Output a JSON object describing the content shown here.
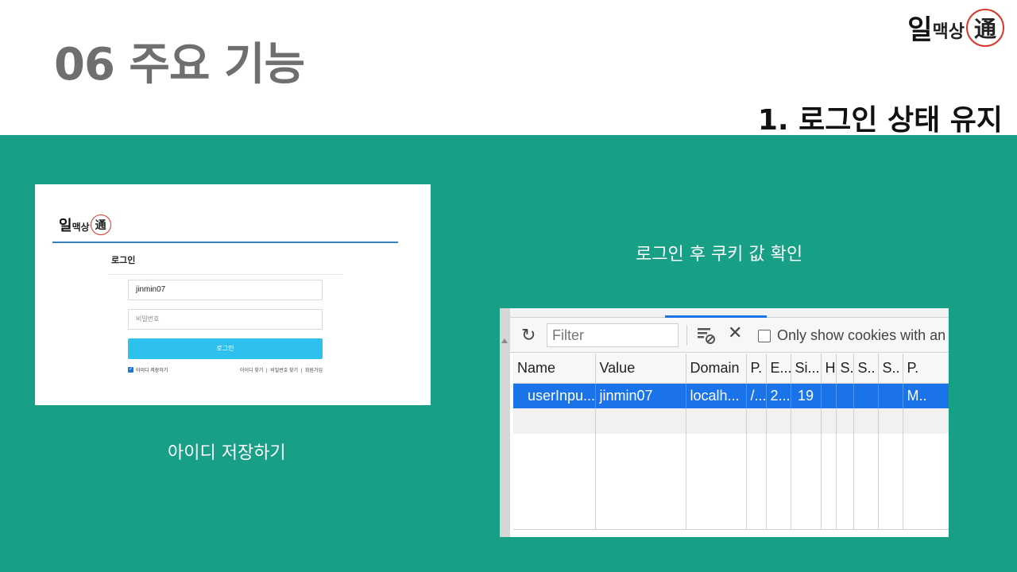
{
  "slide": {
    "title": "06 주요 기능",
    "section": "1. 로그인 상태 유지",
    "brand": {
      "part1": "일",
      "part2": "맥상",
      "seal": "通"
    }
  },
  "login_screenshot": {
    "heading": "로그인",
    "id_value": "jinmin07",
    "password_placeholder": "비밀번호",
    "login_button": "로그인",
    "remember_label": "아이디 저장하기",
    "links": [
      "아이디 찾기",
      "비밀번호 찾기",
      "회원가입"
    ],
    "separator": "|"
  },
  "captions": {
    "left": "아이디 저장하기",
    "right": "로그인 후 쿠키 값 확인"
  },
  "devtools": {
    "filter_placeholder": "Filter",
    "only_show_label": "Only show cookies with an",
    "icons": [
      "refresh-icon",
      "filter-clear-icon",
      "close-icon"
    ],
    "columns": [
      "Name",
      "Value",
      "Domain",
      "P.",
      "E...",
      "Si...",
      "H",
      "S..",
      "S..",
      "S..",
      "P."
    ],
    "rows": [
      [
        "userInpu...",
        "jinmin07",
        "localh...",
        "/...",
        "2...",
        "19",
        "",
        "",
        "",
        "",
        "M.."
      ]
    ],
    "selected_color": "#1a73e8"
  },
  "colors": {
    "band": "#17a086",
    "title": "#6f6f6f",
    "login_button": "#2ec1ee"
  }
}
